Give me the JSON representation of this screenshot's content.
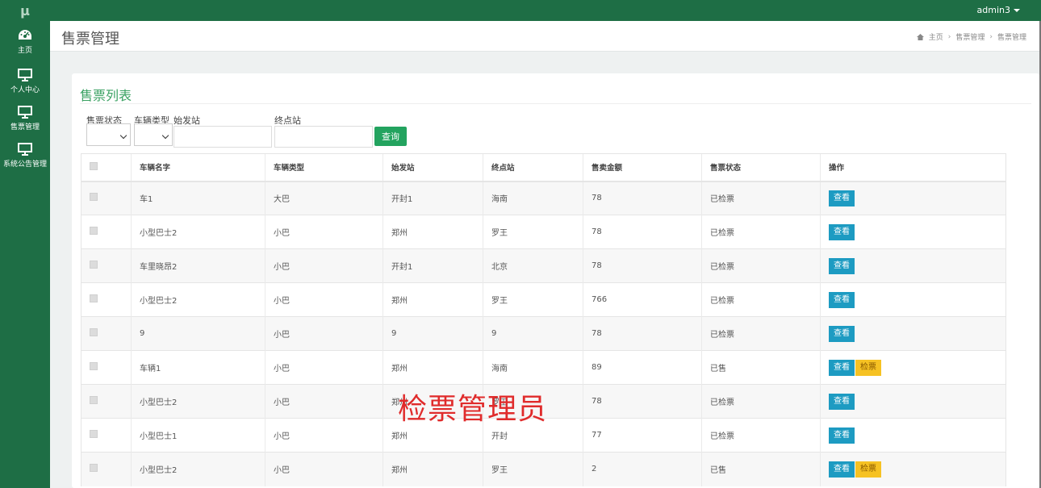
{
  "app": {
    "logo": "μ",
    "user": "admin3"
  },
  "sidebar": {
    "items": [
      {
        "label": "主页",
        "icon": "dashboard-icon"
      },
      {
        "label": "个人中心",
        "icon": "monitor-icon"
      },
      {
        "label": "售票管理",
        "icon": "monitor-icon"
      },
      {
        "label": "系统公告管理",
        "icon": "monitor-icon"
      }
    ]
  },
  "header": {
    "title": "售票管理",
    "breadcrumb": [
      "主页",
      "售票管理",
      "售票管理"
    ]
  },
  "panel": {
    "title": "售票列表",
    "filters": {
      "status_label": "售票状态",
      "vehicle_type_label": "车辆类型",
      "origin_label": "始发站",
      "destination_label": "终点站",
      "query_button": "查询"
    },
    "table": {
      "columns": [
        "车辆名字",
        "车辆类型",
        "始发站",
        "终点站",
        "售卖金额",
        "售票状态",
        "操作"
      ],
      "view_label": "查看",
      "check_label": "检票",
      "rows": [
        {
          "name": "车1",
          "type": "大巴",
          "origin": "开封1",
          "dest": "海南",
          "amount": "78",
          "status": "已检票",
          "check": false
        },
        {
          "name": "小型巴士2",
          "type": "小巴",
          "origin": "郑州",
          "dest": "罗王",
          "amount": "78",
          "status": "已检票",
          "check": false
        },
        {
          "name": "车里晓昂2",
          "type": "小巴",
          "origin": "开封1",
          "dest": "北京",
          "amount": "78",
          "status": "已检票",
          "check": false
        },
        {
          "name": "小型巴士2",
          "type": "小巴",
          "origin": "郑州",
          "dest": "罗王",
          "amount": "766",
          "status": "已检票",
          "check": false
        },
        {
          "name": "9",
          "type": "小巴",
          "origin": "9",
          "dest": "9",
          "amount": "78",
          "status": "已检票",
          "check": false
        },
        {
          "name": "车辆1",
          "type": "小巴",
          "origin": "郑州",
          "dest": "海南",
          "amount": "89",
          "status": "已售",
          "check": true
        },
        {
          "name": "小型巴士2",
          "type": "小巴",
          "origin": "郑州",
          "dest": "罗王",
          "amount": "78",
          "status": "已检票",
          "check": false
        },
        {
          "name": "小型巴士1",
          "type": "小巴",
          "origin": "郑州",
          "dest": "开封",
          "amount": "77",
          "status": "已检票",
          "check": false
        },
        {
          "name": "小型巴士2",
          "type": "小巴",
          "origin": "郑州",
          "dest": "罗王",
          "amount": "2",
          "status": "已售",
          "check": true
        }
      ]
    }
  },
  "overlay": {
    "caption": "检票管理员",
    "color": "#e02b2b"
  },
  "colors": {
    "brand": "#1e6e45",
    "title_green": "#3aa162",
    "query_button": "#23a35f",
    "view_button": "#1d9bc2",
    "check_button": "#f6c223"
  }
}
